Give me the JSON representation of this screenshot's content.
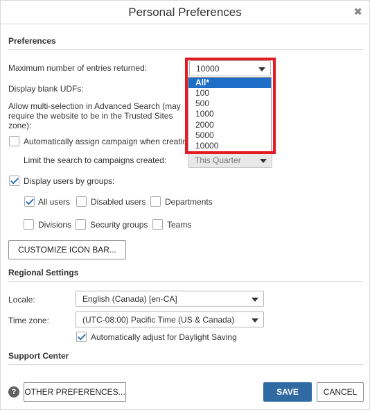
{
  "dialog": {
    "title": "Personal Preferences",
    "close_glyph": "✖"
  },
  "preferences": {
    "section_title": "Preferences",
    "max_entries_label": "Maximum number of entries returned:",
    "max_entries_value": "10000",
    "max_entries_options": [
      "All*",
      "100",
      "500",
      "1000",
      "2000",
      "5000",
      "10000"
    ],
    "max_entries_highlighted": "All*",
    "display_blank_udfs_label": "Display blank UDFs:",
    "multiselect_label": "Allow multi-selection in Advanced Search (may require the website to be in the Trusted Sites zone):",
    "auto_assign_campaign_label": "Automatically assign campaign when creatin",
    "auto_assign_campaign_checked": false,
    "limit_search_label": "Limit the search to campaigns created:",
    "limit_search_value": "This Quarter",
    "display_users_by_groups_label": "Display users by groups:",
    "display_users_by_groups_checked": true,
    "groups": [
      {
        "label": "All users",
        "checked": true
      },
      {
        "label": "Disabled users",
        "checked": false
      },
      {
        "label": "Departments",
        "checked": false
      },
      {
        "label": "Divisions",
        "checked": false
      },
      {
        "label": "Security groups",
        "checked": false
      },
      {
        "label": "Teams",
        "checked": false
      }
    ],
    "customize_icon_bar_label": "CUSTOMIZE ICON BAR..."
  },
  "regional": {
    "section_title": "Regional Settings",
    "locale_label": "Locale:",
    "locale_value": "English (Canada) [en-CA]",
    "timezone_label": "Time zone:",
    "timezone_value": "(UTC-08:00) Pacific Time (US & Canada)",
    "daylight_label": "Automatically adjust for Daylight Saving",
    "daylight_checked": true
  },
  "support": {
    "section_title": "Support Center"
  },
  "footer": {
    "help_glyph": "?",
    "other_preferences_label": "OTHER PREFERENCES...",
    "save_label": "SAVE",
    "cancel_label": "CANCEL"
  },
  "colors": {
    "accent": "#2f6aa3",
    "highlight_border": "#e31b23",
    "selected_option": "#1e6ec8"
  }
}
